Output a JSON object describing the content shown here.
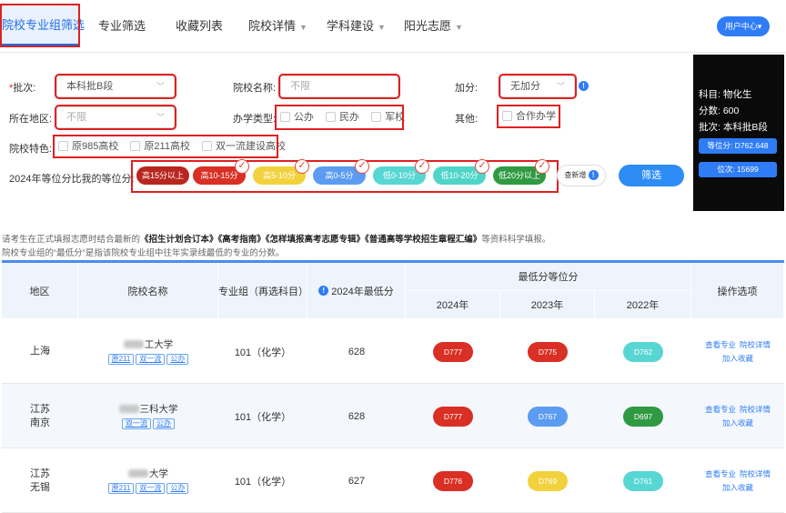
{
  "nav": {
    "items": [
      {
        "label": "院校专业组筛选"
      },
      {
        "label": "专业筛选"
      },
      {
        "label": "收藏列表"
      },
      {
        "label": "院校详情",
        "caret": "▼"
      },
      {
        "label": "学科建设",
        "caret": "▼"
      },
      {
        "label": "阳光志愿",
        "caret": "▼"
      }
    ],
    "user_center": "用户中心▾"
  },
  "filters": {
    "batch_label": "*批次:",
    "batch_value": "本科批B段",
    "school_name_label": "院校名称:",
    "school_name_placeholder": "不限",
    "bonus_label": "加分:",
    "bonus_value": "无加分",
    "region_label": "所在地区:",
    "region_placeholder": "不限",
    "school_type_label": "办学类型:",
    "school_types": [
      "公办",
      "民办",
      "军校"
    ],
    "other_label": "其他:",
    "other_options": [
      "合作办学"
    ],
    "feature_label": "院校特色:",
    "features": [
      "原985高校",
      "原211高校",
      "双一流建设高校"
    ],
    "rank_compare_label": "2024年等位分比我的等位分:",
    "rank_pills": [
      {
        "label": "高15分以上",
        "color": "#b8261f",
        "checked": false
      },
      {
        "label": "高10-15分",
        "color": "#d92f24",
        "checked": true
      },
      {
        "label": "高5-10分",
        "color": "#f2d23c",
        "checked": true
      },
      {
        "label": "高0-5分",
        "color": "#5b9cf0",
        "checked": true
      },
      {
        "label": "低0-10分",
        "color": "#58d6d4",
        "checked": true
      },
      {
        "label": "低10-20分",
        "color": "#4fd5c8",
        "checked": true
      },
      {
        "label": "低20分以上",
        "color": "#2f9a42",
        "checked": true
      }
    ],
    "recalc_label": "查新增",
    "screen_button": "筛选"
  },
  "score_panel": {
    "subjects": "科目: 物化生",
    "score": "分数: 600",
    "batch": "批次: 本科批B段",
    "equiv_score": "等位分: D762.648",
    "rank": "位次: 15699"
  },
  "notes": {
    "line1_prefix": "请考生在正式填报志愿时结合最新的",
    "line1_books": "《招生计划合订本》《高考指南》《怎样填报高考志愿专辑》《普通高等学校招生章程汇编》",
    "line1_suffix": "等资料科学填报。",
    "line2": "院校专业组的“最低分”是指该院校专业组中往年实录线最低的专业的分数。"
  },
  "table": {
    "headers": {
      "region": "地区",
      "school": "院校名称",
      "group": "专业组（再选科目）",
      "min2024": "2024年最低分",
      "rank_group": "最低分等位分",
      "y2024": "2024年",
      "y2023": "2023年",
      "y2022": "2022年",
      "ops": "操作选项"
    },
    "rows": [
      {
        "region1": "上海",
        "region2": "",
        "school_visible": "工大学",
        "tags": [
          "原211",
          "双一流",
          "公办"
        ],
        "group": "101（化学）",
        "min2024": "628",
        "r2024": {
          "text": "D777",
          "color": "#d92f24"
        },
        "r2023": {
          "text": "D775",
          "color": "#d92f24"
        },
        "r2022": {
          "text": "D762",
          "color": "#58d6d4"
        }
      },
      {
        "region1": "江苏",
        "region2": "南京",
        "school_visible": "三科大学",
        "tags": [
          "双一流",
          "公办"
        ],
        "group": "101（化学）",
        "min2024": "628",
        "r2024": {
          "text": "D777",
          "color": "#d92f24"
        },
        "r2023": {
          "text": "D767",
          "color": "#5b9cf0"
        },
        "r2022": {
          "text": "D697",
          "color": "#2f9a42"
        }
      },
      {
        "region1": "江苏",
        "region2": "无锡",
        "school_visible": "大学",
        "tags": [
          "原211",
          "双一流",
          "公办"
        ],
        "group": "101（化学）",
        "min2024": "627",
        "r2024": {
          "text": "D776",
          "color": "#d92f24"
        },
        "r2023": {
          "text": "D769",
          "color": "#f2d23c"
        },
        "r2022": {
          "text": "D761",
          "color": "#58d6d4"
        }
      }
    ],
    "ops": {
      "view_major": "查看专业",
      "school_detail": "院校详情",
      "add_fav": "加入收藏"
    }
  },
  "colors": {
    "accent": "#2e7cf6",
    "highlight": "#e02020"
  }
}
